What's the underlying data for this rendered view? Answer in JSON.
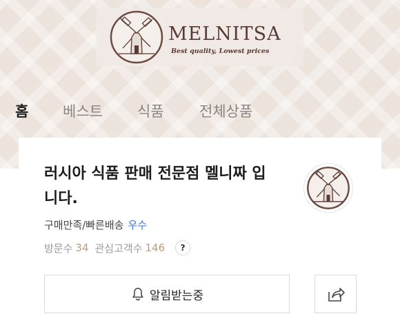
{
  "header": {
    "logo": {
      "name": "MELNITSA",
      "tagline": "Best quality, Lowest prices",
      "icon": "windmill-logo-icon"
    }
  },
  "nav": {
    "tabs": [
      {
        "label": "홈",
        "active": true
      },
      {
        "label": "베스트",
        "active": false
      },
      {
        "label": "식품",
        "active": false
      },
      {
        "label": "전체상품",
        "active": false
      }
    ]
  },
  "store": {
    "title": "러시아 식품 판매 전문점 멜니짜 입니다.",
    "avatar_icon": "windmill-logo-icon",
    "review_label": "구매만족/빠른배송",
    "review_grade": "우수",
    "visitors_label": "방문수",
    "visitors_value": "34",
    "followers_label": "관심고객수",
    "followers_value": "146",
    "help_label": "?"
  },
  "actions": {
    "notify_label": "알림받는중",
    "notify_icon": "bell-icon",
    "share_icon": "share-icon"
  },
  "colors": {
    "header_bg": "#ece3dd",
    "brand": "#5a3a34",
    "grade_blue": "#3b77d3",
    "stat_accent": "#b79c7e"
  }
}
